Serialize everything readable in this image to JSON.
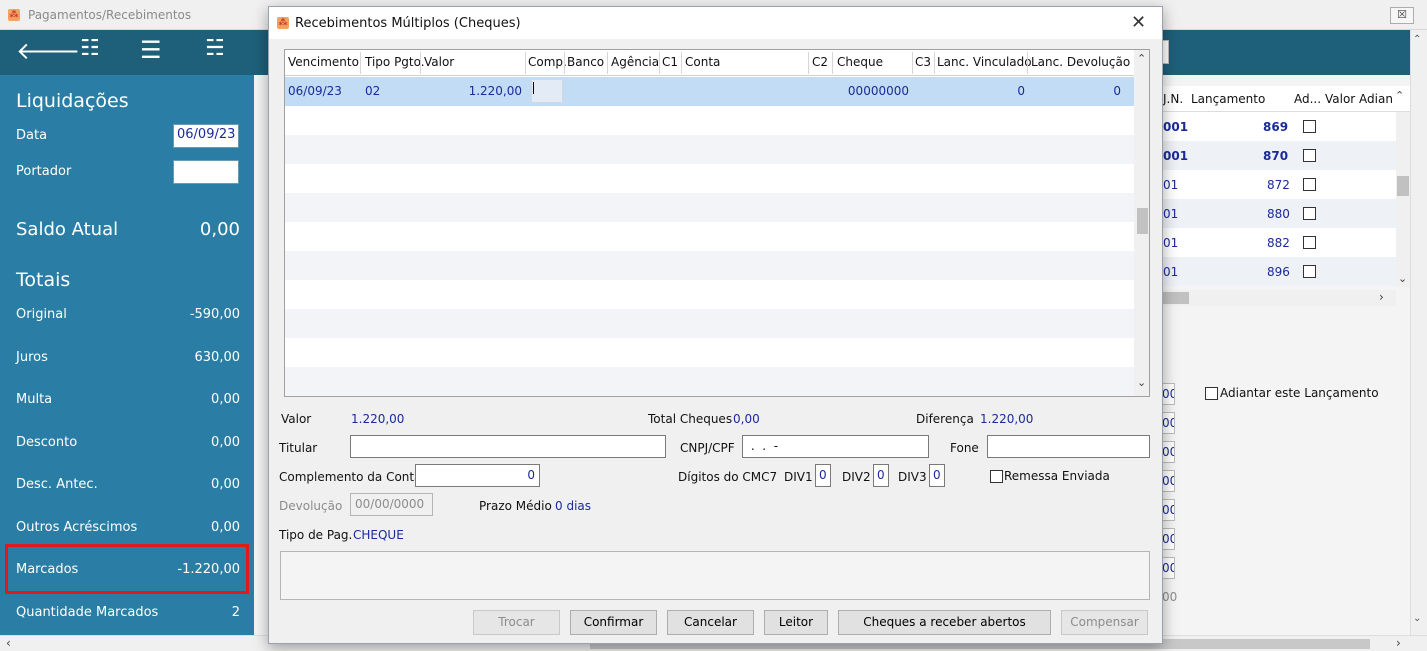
{
  "main_window": {
    "title": "Pagamentos/Recebimentos",
    "close_glyph": "☒"
  },
  "toolbar_icons": [
    "arrow-left-icon",
    "checklist-icon",
    "menu-icon",
    "checklist-alt-icon"
  ],
  "sidebar": {
    "liquidacoes_title": "Liquidações",
    "data_label": "Data",
    "data_value": "06/09/23",
    "portador_label": "Portador",
    "portador_value": "",
    "saldo_label": "Saldo Atual",
    "saldo_value": "0,00",
    "totais_title": "Totais",
    "rows": [
      {
        "label": "Original",
        "value": "-590,00"
      },
      {
        "label": "Juros",
        "value": "630,00"
      },
      {
        "label": "Multa",
        "value": "0,00"
      },
      {
        "label": "Desconto",
        "value": "0,00"
      },
      {
        "label": "Desc. Antec.",
        "value": "0,00"
      },
      {
        "label": "Outros Acréscimos",
        "value": "0,00"
      },
      {
        "label": "Marcados",
        "value": "-1.220,00"
      },
      {
        "label": "Quantidade Marcados",
        "value": "2"
      }
    ],
    "highlight_color": "#e0191f"
  },
  "background_grid": {
    "headers": [
      "J.N.",
      "Lançamento",
      "Ad...",
      "Valor Adianta"
    ],
    "rows": [
      {
        "a": "001",
        "lanc": "869"
      },
      {
        "a": "001",
        "lanc": "870"
      },
      {
        "a": "01",
        "lanc": "872"
      },
      {
        "a": "01",
        "lanc": "880"
      },
      {
        "a": "01",
        "lanc": "882"
      },
      {
        "a": "01",
        "lanc": "896"
      }
    ],
    "adiantar_label": "Adiantar este Lançamento",
    "partial_values": [
      "00",
      "00",
      "00",
      "00",
      "00",
      "00",
      "00",
      "00"
    ]
  },
  "dialog": {
    "title": "Recebimentos Múltiplos (Cheques)",
    "close_glyph": "✕",
    "grid": {
      "headers": [
        "Vencimento",
        "Tipo Pgto.",
        "Valor",
        "Comp.",
        "Banco",
        "Agência",
        "C1",
        "Conta",
        "C2",
        "Cheque",
        "C3",
        "Lanc. Vinculado",
        "Lanc. Devolução"
      ],
      "selected_row": {
        "vencimento": "06/09/23",
        "tipo": "02",
        "valor": "1.220,00",
        "cheque": "00000000",
        "lanc_vinculado": "0",
        "lanc_devolucao": "0"
      }
    },
    "valor_label": "Valor",
    "valor_value": "1.220,00",
    "total_cheques_label": "Total Cheques",
    "total_cheques_value": "0,00",
    "diferenca_label": "Diferença",
    "diferenca_value": "1.220,00",
    "titular_label": "Titular",
    "titular_value": "",
    "cnpj_label": "CNPJ/CPF",
    "cnpj_value": " .  .  -",
    "fone_label": "Fone",
    "fone_value": "",
    "complemento_label": "Complemento da Conta",
    "complemento_value": "0",
    "cmc7_label": "Dígitos do CMC7",
    "div1_label": "DIV1",
    "div1_value": "0",
    "div2_label": "DIV2",
    "div2_value": "0",
    "div3_label": "DIV3",
    "div3_value": "0",
    "remessa_label": "Remessa Enviada",
    "devolucao_label": "Devolução",
    "devolucao_value": "00/00/0000",
    "prazo_label": "Prazo Médio",
    "prazo_value": "0 dias",
    "tipo_pag_label": "Tipo de Pag.",
    "tipo_pag_value": "CHEQUE",
    "buttons": {
      "trocar": "Trocar",
      "confirmar": "Confirmar",
      "cancelar": "Cancelar",
      "leitor": "Leitor",
      "cheques_abertos": "Cheques a receber abertos",
      "compensar": "Compensar"
    }
  }
}
